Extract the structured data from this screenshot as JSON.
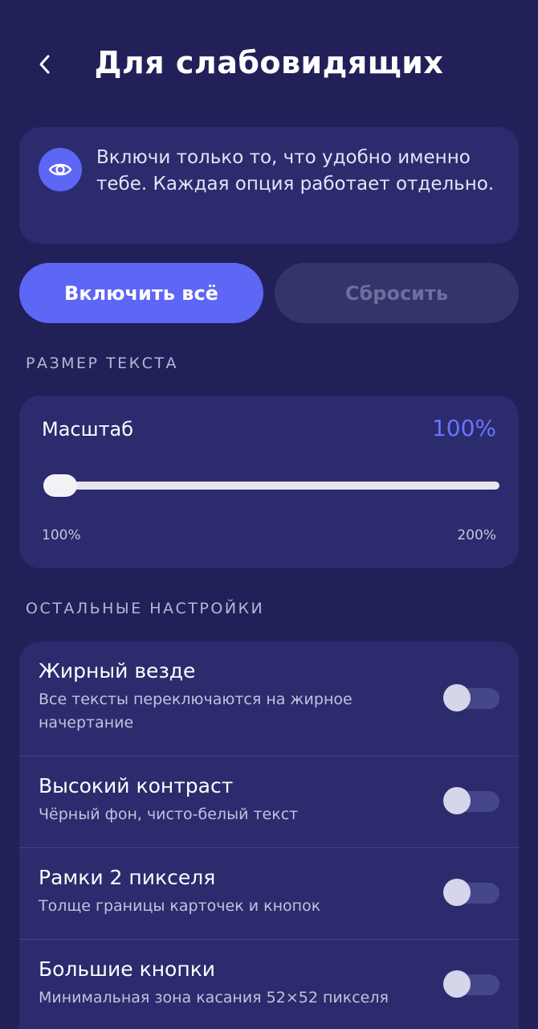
{
  "header": {
    "title": "Для слабовидящих",
    "back_icon": "chevron-left-icon"
  },
  "info": {
    "icon": "eye-icon",
    "text": "Включи только то, что удобно именно тебе. Каждая опция работает отдельно."
  },
  "actions": {
    "enable_all": "Включить всё",
    "reset": "Сбросить"
  },
  "text_size": {
    "section_label": "РАЗМЕР ТЕКСТА",
    "scale_label": "Масштаб",
    "value": "100%",
    "min_label": "100%",
    "max_label": "200%",
    "slider_fraction": 0
  },
  "other": {
    "section_label": "ОСТАЛЬНЫЕ НАСТРОЙКИ",
    "items": [
      {
        "title": "Жирный везде",
        "description": "Все тексты переключаются на жирное начертание",
        "enabled": false
      },
      {
        "title": "Высокий контраст",
        "description": "Чёрный фон, чисто-белый текст",
        "enabled": false
      },
      {
        "title": "Рамки 2 пикселя",
        "description": "Толще границы карточек и кнопок",
        "enabled": false
      },
      {
        "title": "Большие кнопки",
        "description": "Минимальная зона касания 52×52 пикселя",
        "enabled": false
      }
    ]
  },
  "colors": {
    "background": "#212058",
    "card": "#2c2b6e",
    "accent": "#5e66f5",
    "value_text": "#6a74ff"
  }
}
